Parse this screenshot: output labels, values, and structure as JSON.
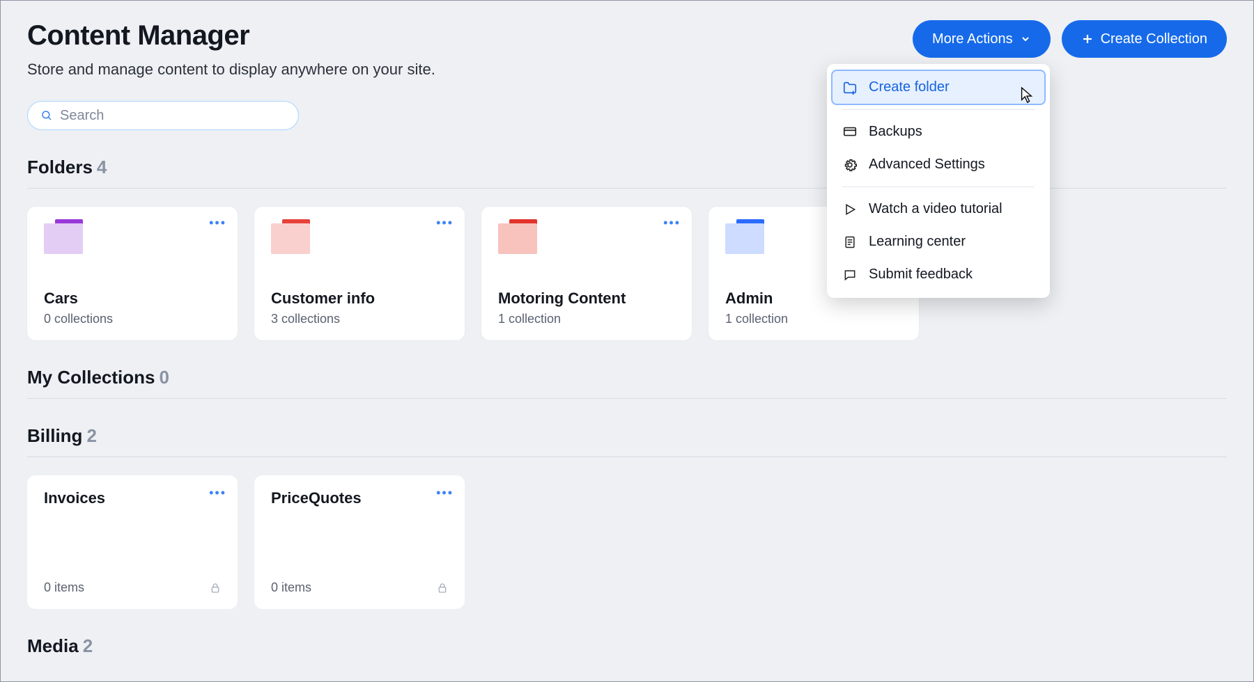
{
  "header": {
    "title": "Content Manager",
    "subtitle": "Store and manage content to display anywhere on your site.",
    "moreActionsLabel": "More Actions",
    "createCollectionLabel": "Create Collection"
  },
  "search": {
    "placeholder": "Search",
    "value": ""
  },
  "moreActionsMenu": {
    "items": [
      {
        "label": "Create folder",
        "icon": "folder-plus-icon"
      },
      {
        "label": "Backups",
        "icon": "stack-icon"
      },
      {
        "label": "Advanced Settings",
        "icon": "gear-icon"
      },
      {
        "label": "Watch a video tutorial",
        "icon": "play-icon"
      },
      {
        "label": "Learning center",
        "icon": "doc-icon"
      },
      {
        "label": "Submit feedback",
        "icon": "chat-icon"
      }
    ]
  },
  "sections": {
    "folders": {
      "title": "Folders",
      "count": "4"
    },
    "myCollections": {
      "title": "My Collections",
      "count": "0"
    },
    "billing": {
      "title": "Billing",
      "count": "2"
    },
    "media": {
      "title": "Media",
      "count": "2"
    }
  },
  "folders": [
    {
      "label": "Cars",
      "sub": "0 collections",
      "color": "purple"
    },
    {
      "label": "Customer info",
      "sub": "3 collections",
      "color": "pink"
    },
    {
      "label": "Motoring Content",
      "sub": "1 collection",
      "color": "red"
    },
    {
      "label": "Admin",
      "sub": "1 collection",
      "color": "blue"
    }
  ],
  "billingCollections": [
    {
      "label": "Invoices",
      "sub": "0 items"
    },
    {
      "label": "PriceQuotes",
      "sub": "0 items"
    }
  ]
}
